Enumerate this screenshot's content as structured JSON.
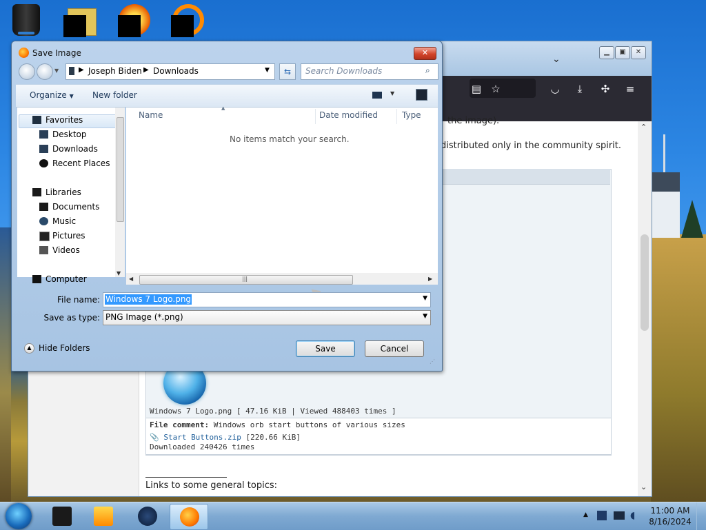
{
  "desktop": {
    "icons": [
      "recycle-bin",
      "libraries-folder",
      "media-player",
      "firefox"
    ]
  },
  "browser": {
    "visible_text": {
      "line1": "the image).",
      "line2": "distributed only in the community spirit.",
      "file_info": "Windows 7 Logo.png [ 47.16 KiB | Viewed 488403 times ]",
      "file_comment_label": "File comment:",
      "file_comment": "Windows orb start buttons of various sizes",
      "attachment_link": "Start Buttons.zip",
      "attachment_size": "[220.66 KiB]",
      "downloaded": "Downloaded 240426 times",
      "links_heading": "Links to some general topics:"
    }
  },
  "dialog": {
    "title": "Save Image",
    "close": "✕",
    "breadcrumb": [
      "Joseph Biden",
      "Downloads"
    ],
    "search_placeholder": "Search Downloads",
    "organize_label": "Organize",
    "new_folder_label": "New folder",
    "tree": {
      "favorites": "Favorites",
      "desktop": "Desktop",
      "downloads": "Downloads",
      "recent_places": "Recent Places",
      "libraries": "Libraries",
      "documents": "Documents",
      "music": "Music",
      "pictures": "Pictures",
      "videos": "Videos",
      "computer": "Computer"
    },
    "columns": {
      "name": "Name",
      "date_modified": "Date modified",
      "type": "Type"
    },
    "empty_message": "No items match your search.",
    "file_name_label": "File name:",
    "file_name_value": "Windows 7 Logo.png",
    "save_as_type_label": "Save as type:",
    "save_as_type_value": "PNG Image (*.png)",
    "hide_folders_label": "Hide Folders",
    "save_label": "Save",
    "cancel_label": "Cancel"
  },
  "taskbar": {
    "time": "11:00 AM",
    "date": "8/16/2024"
  }
}
